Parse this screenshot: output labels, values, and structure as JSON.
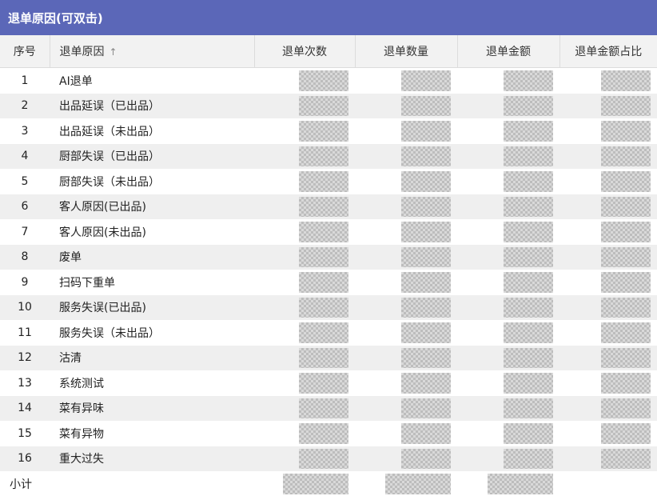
{
  "panel": {
    "title": "退单原因(可双击)"
  },
  "table": {
    "headers": [
      "序号",
      "退单原因",
      "退单次数",
      "退单数量",
      "退单金额",
      "退单金额占比"
    ],
    "sort_icon": "sort-up-icon",
    "rows": [
      {
        "no": "1",
        "reason": "AI退单"
      },
      {
        "no": "2",
        "reason": "出品延误（已出品）"
      },
      {
        "no": "3",
        "reason": "出品延误（未出品）"
      },
      {
        "no": "4",
        "reason": "厨部失误（已出品）"
      },
      {
        "no": "5",
        "reason": "厨部失误（未出品）"
      },
      {
        "no": "6",
        "reason": "客人原因(已出品)"
      },
      {
        "no": "7",
        "reason": "客人原因(未出品)"
      },
      {
        "no": "8",
        "reason": "废单"
      },
      {
        "no": "9",
        "reason": "扫码下重单"
      },
      {
        "no": "10",
        "reason": "服务失误(已出品)"
      },
      {
        "no": "11",
        "reason": "服务失误（未出品）"
      },
      {
        "no": "12",
        "reason": "沽清"
      },
      {
        "no": "13",
        "reason": "系统测试"
      },
      {
        "no": "14",
        "reason": "菜有异味"
      },
      {
        "no": "15",
        "reason": "菜有异物"
      },
      {
        "no": "16",
        "reason": "重大过失"
      }
    ],
    "subtotal_label": "小计"
  },
  "colors": {
    "header_bg": "#5b67b8",
    "row_alt": "#efefef"
  }
}
